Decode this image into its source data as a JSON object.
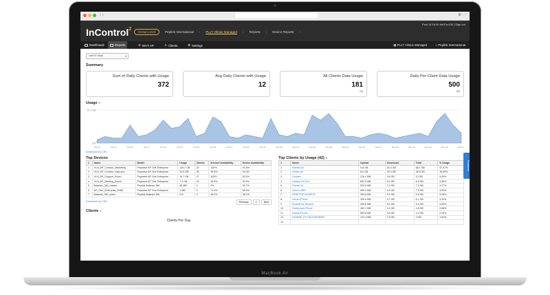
{
  "device": {
    "brand": "MacBook Air"
  },
  "app": {
    "logo": "InControl",
    "logo_mark": "2",
    "user_line": "Paul  14:15:00 #rKFxc100  |  Sign out",
    "breadcrumbs": [
      "Group Level",
      "Peplink International",
      "PLLT Vilnius Managed",
      "Reports",
      "Device Reports"
    ],
    "toolbar": {
      "items": [
        "Dashboard",
        "Reports",
        "Wi-Fi AP",
        "Clients",
        "Settings"
      ],
      "right": [
        "PLLT Vilnius Managed",
        "Peplink International"
      ]
    }
  },
  "filter": {
    "range": "Last 07 Days"
  },
  "summary": {
    "title": "Summary",
    "cards": [
      {
        "title": "Sum of Daily Clients with Usage",
        "value": "372",
        "unit": ""
      },
      {
        "title": "Avg Daily Clients with Usage",
        "value": "12",
        "unit": ""
      },
      {
        "title": "All Clients Data Usage",
        "value": "181",
        "unit": "GB"
      },
      {
        "title": "Daily Per-Client Data Usage",
        "value": "500",
        "unit": "MB"
      }
    ]
  },
  "usage": {
    "title": "Usage",
    "download_csv": "Download as CSV"
  },
  "chart_data": {
    "type": "area",
    "title": "Usage",
    "yticks": [
      "20.1 GB",
      "0 B"
    ],
    "ylim": [
      0,
      20.1
    ],
    "categories": [
      "Oct 11",
      "Oct 13",
      "Oct 15",
      "Oct 17",
      "Oct 19",
      "Oct 21",
      "Oct 23",
      "Oct 25",
      "Oct 27",
      "Oct 29",
      "Oct 31",
      "Nov 02",
      "Nov 04",
      "Nov 06",
      "Nov 08",
      "Nov 10",
      "Nov 12",
      "Nov 14",
      "Nov 16",
      "Nov 18",
      "Nov 20",
      "Nov 22",
      "Nov 24"
    ],
    "values": [
      2,
      4,
      3,
      3,
      11,
      4,
      5,
      8,
      14,
      9,
      10,
      15,
      4,
      6,
      16,
      13,
      4,
      3,
      5,
      4,
      3,
      15,
      5,
      4,
      6,
      5,
      17,
      14,
      18,
      12,
      4,
      4,
      3,
      5,
      6,
      5,
      3,
      4,
      5,
      6,
      4,
      13,
      18,
      11,
      6
    ]
  },
  "top_devices": {
    "title": "Top Devices",
    "download_csv": "Download as CSV",
    "columns": [
      "#",
      "Name",
      "Model",
      "Usage",
      "Clients",
      "Internet Availability",
      "Device Availability"
    ],
    "rows": [
      [
        "1",
        "VLN_AP_Corridor_Marketing",
        "Pepwave AP One Enterprise",
        "116.7 GB",
        "24",
        "100%",
        "93.3%"
      ],
      [
        "2",
        "VLN_AP_Corridor_Vanroom",
        "Pepwave AP One Enterprise",
        "24.9 GB",
        "33",
        "99.9%",
        "93.3%"
      ],
      [
        "3",
        "VLN_AP_Support_Room",
        "Pepwave AP One Enterprise",
        "14.7 GB",
        "27",
        "100%",
        "93.3%"
      ],
      [
        "4",
        "VLN_AP_Meeting_Room",
        "Pepwave AP One Enterprise",
        "7.2 GB",
        "22",
        "99.9%",
        "93.3%"
      ],
      [
        "5",
        "Balance_380_master",
        "Peplink Balance 380",
        "80 MB",
        "2",
        "0%",
        "36.7%"
      ],
      [
        "6",
        "AP_One_Enterprise_B1B4",
        "Pepwave AP One Enterprise",
        "1 MB",
        "0",
        "71.9%",
        "68.4%"
      ],
      [
        "7",
        "Balance_380_slave",
        "Peplink Balance 380",
        "0 B",
        "0",
        "99.2%",
        "38.1%"
      ]
    ],
    "pager": [
      "Previous",
      "1",
      "Next"
    ]
  },
  "clients": {
    "title": "Clients",
    "chart_title": "Clients Per Day"
  },
  "top_clients": {
    "title": "Top Clients by Usage (42)",
    "columns": [
      "#",
      "Name",
      "Upload",
      "Download",
      "Total",
      "% Usage"
    ],
    "rows": [
      [
        "1",
        "Mantas-Air",
        "9.8 GB",
        "54.3 GB",
        "58.1 GB",
        "37.41%"
      ],
      [
        "2",
        "Gintes-Air",
        "8.9 GB",
        "25.9 GB",
        "28.8 GB",
        "15.59%"
      ],
      [
        "3",
        "Gedaim",
        "216.4 MB",
        "9.8 GB",
        "13 GB",
        "5.59%"
      ],
      [
        "4",
        "Galaxy-A5-2017",
        "692.3 MB",
        "8.2 GB",
        "8.9 GB",
        "4.89%"
      ],
      [
        "5",
        "Pokste-Air",
        "522.6 MB",
        "7.4 GB",
        "7.9 GB",
        "4.27%"
      ],
      [
        "6",
        "Virbu's-MBP",
        "530.5 MB",
        "6.9 GB",
        "7.5 GB",
        "4.09%"
      ],
      [
        "7",
        "DESKTOP-5U05S78",
        "390.8 MB",
        "5.5 GB",
        "5.8 GB",
        "3.25%"
      ],
      [
        "8",
        "Virtum-iPhone",
        "325.5 MB",
        "5.7 GB",
        "6.1 GB",
        "3.34%"
      ],
      [
        "9",
        "RedmiPlus-Redmi5",
        "335.8 MB",
        "5.5 GB",
        "5.9 GB",
        "3.65%"
      ],
      [
        "10",
        "SaidArvyai-iPhone",
        "402.1 MB",
        "4.4 GB",
        "4.8 GB",
        "2.68%"
      ],
      [
        "11",
        "Rokas-iPhone",
        "560.8 MB",
        "3.6 GB",
        "4.2 GB",
        "2.20%"
      ],
      [
        "12",
        "HUAWEI_P10-BUZXNGB905",
        "131.4 MB",
        "2.9 GB",
        "3 GB",
        "1.64%"
      ],
      [
        "13",
        "",
        "",
        "",
        "",
        ""
      ]
    ]
  },
  "feedback": "Feedback"
}
